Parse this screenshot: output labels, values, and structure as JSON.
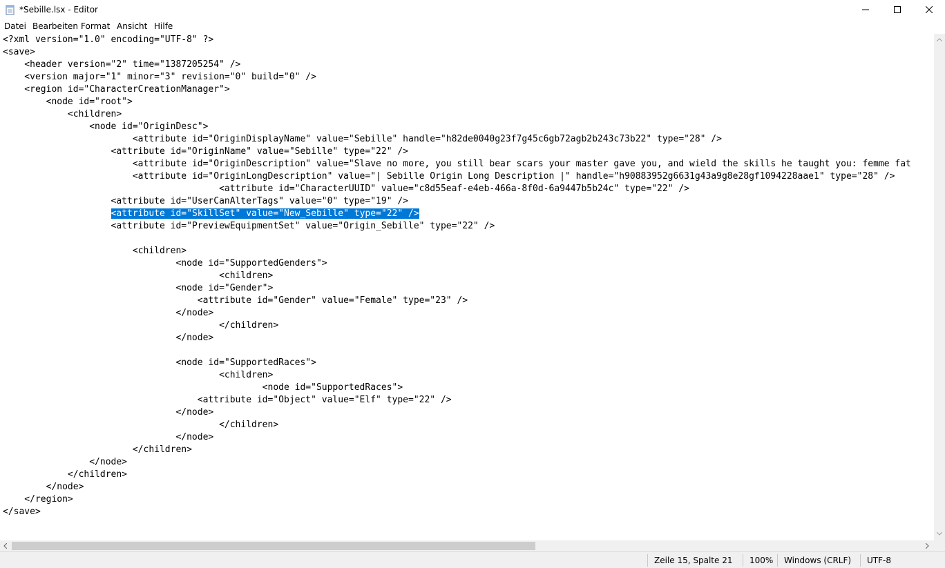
{
  "window": {
    "title": "*Sebille.lsx - Editor"
  },
  "menu": [
    "Datei",
    "Bearbeiten",
    "Format",
    "Ansicht",
    "Hilfe"
  ],
  "editor": {
    "lines": [
      "<?xml version=\"1.0\" encoding=\"UTF-8\" ?>",
      "<save>",
      "    <header version=\"2\" time=\"1387205254\" />",
      "    <version major=\"1\" minor=\"3\" revision=\"0\" build=\"0\" />",
      "    <region id=\"CharacterCreationManager\">",
      "        <node id=\"root\">",
      "            <children>",
      "                <node id=\"OriginDesc\">",
      "                        <attribute id=\"OriginDisplayName\" value=\"Sebille\" handle=\"h82de0040g23f7g45c6gb72agb2b243c73b22\" type=\"28\" />",
      "                    <attribute id=\"OriginName\" value=\"Sebille\" type=\"22\" />",
      "                        <attribute id=\"OriginDescription\" value=\"Slave no more, you still bear scars your master gave you, and wield the skills he taught you: femme fat",
      "                        <attribute id=\"OriginLongDescription\" value=\"| Sebille Origin Long Description |\" handle=\"h90883952g6631g43a9g8e28gf1094228aae1\" type=\"28\" />",
      "                                        <attribute id=\"CharacterUUID\" value=\"c8d55eaf-e4eb-466a-8f0d-6a9447b5b24c\" type=\"22\" />",
      "                    <attribute id=\"UserCanAlterTags\" value=\"0\" type=\"19\" />",
      "                    <attribute id=\"SkillSet\" value=\"New_Sebille\" type=\"22\" />",
      "                    <attribute id=\"PreviewEquipmentSet\" value=\"Origin_Sebille\" type=\"22\" />",
      "",
      "                        <children>",
      "                                <node id=\"SupportedGenders\">",
      "                                        <children>",
      "                                <node id=\"Gender\">",
      "                                    <attribute id=\"Gender\" value=\"Female\" type=\"23\" />",
      "                                </node>",
      "                                        </children>",
      "                                </node>",
      "",
      "                                <node id=\"SupportedRaces\">",
      "                                        <children>",
      "                                                <node id=\"SupportedRaces\">",
      "                                    <attribute id=\"Object\" value=\"Elf\" type=\"22\" />",
      "                                </node>",
      "                                        </children>",
      "                                </node>",
      "                        </children>",
      "                </node>",
      "            </children>",
      "        </node>",
      "    </region>",
      "</save>"
    ],
    "selected_line": 14,
    "selection_color": "#0078d7"
  },
  "status": {
    "position": "Zeile 15, Spalte 21",
    "zoom": "100%",
    "line_ending": "Windows (CRLF)",
    "encoding": "UTF-8"
  }
}
